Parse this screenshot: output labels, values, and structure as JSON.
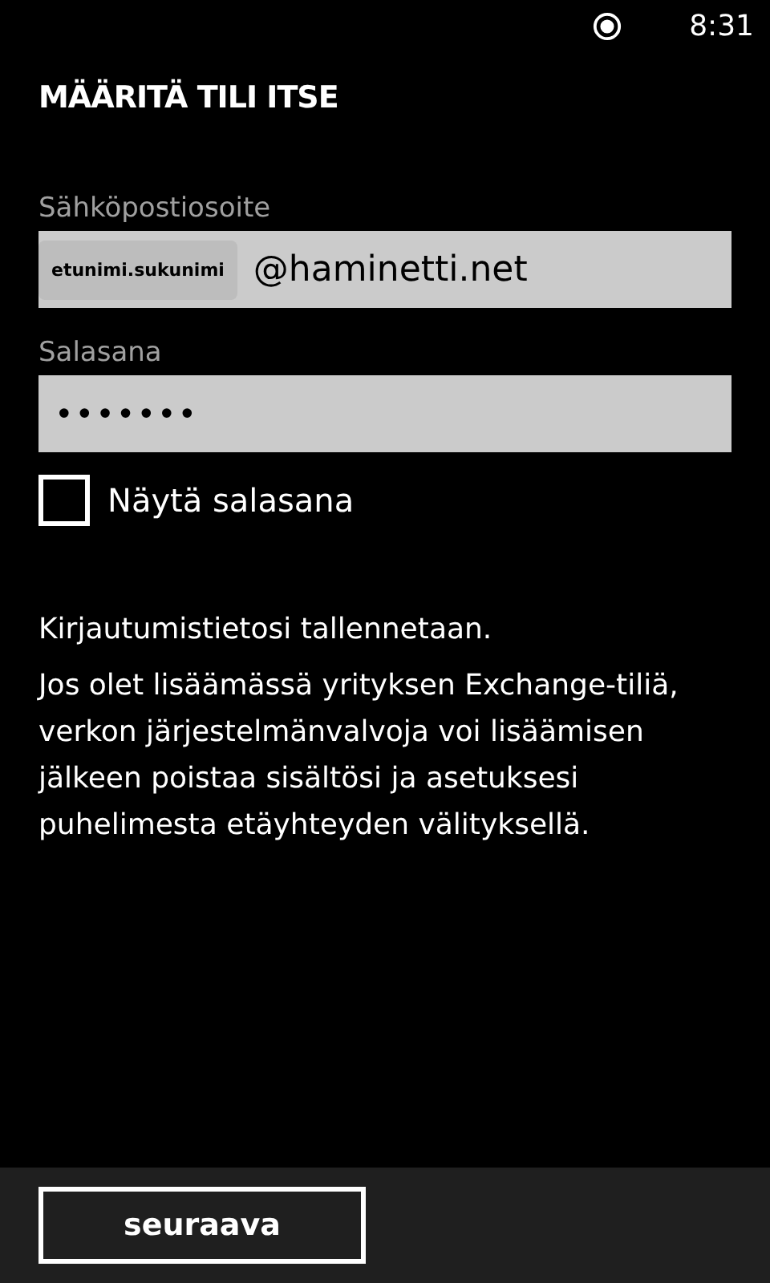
{
  "status_bar": {
    "time": "8:31"
  },
  "title": "MÄÄRITÄ TILI ITSE",
  "email": {
    "label": "Sähköpostiosoite",
    "redaction_label": "etunimi.sukunimi",
    "value": "@haminetti.net"
  },
  "password": {
    "label": "Salasana",
    "value": "•••••••"
  },
  "show_password": {
    "label": "Näytä salasana",
    "checked": false
  },
  "info": [
    "Kirjautumistietosi tallennetaan.",
    "Jos olet lisäämässä yrityksen Exchange-tiliä, verkon järjestelmänvalvoja voi lisäämisen jälkeen poistaa sisältösi ja asetuksesi puhelimesta etäyhteyden välityksellä."
  ],
  "app_bar": {
    "button": "seuraava"
  }
}
